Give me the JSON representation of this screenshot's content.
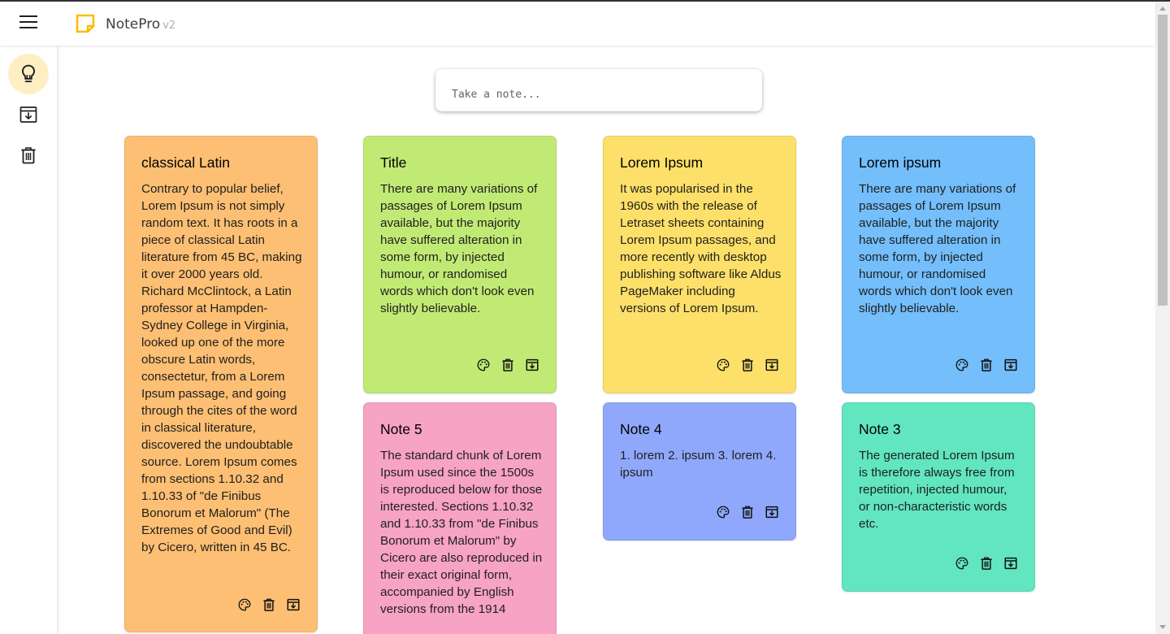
{
  "app": {
    "name": "NotePro",
    "version": "v2"
  },
  "sidebar": {
    "items": [
      {
        "label": "Notes",
        "icon": "lightbulb-icon",
        "active": true
      },
      {
        "label": "Archive",
        "icon": "archive-icon",
        "active": false
      },
      {
        "label": "Trash",
        "icon": "trash-icon",
        "active": false
      }
    ]
  },
  "compose": {
    "placeholder": "Take a note..."
  },
  "colors": {
    "accent": "#feefc3",
    "logo": "#fbbc04"
  },
  "notes": [
    {
      "title": "classical Latin",
      "color": "#fdbf73",
      "body": "Contrary to popular belief, Lorem Ipsum is not simply random text. It has roots in a piece of classical Latin literature from 45 BC, making it over 2000 years old. Richard McClintock, a Latin professor at Hampden-Sydney College in Virginia, looked up one of the more obscure Latin words, consectetur, from a Lorem Ipsum passage, and going through the cites of the word in classical literature, discovered the undoubtable source. Lorem Ipsum comes from sections 1.10.32 and 1.10.33 of \"de Finibus Bonorum et Malorum\" (The Extremes of Good and Evil) by Cicero, written in 45 BC."
    },
    {
      "title": "Title",
      "color": "#c1ea75",
      "body": "There are many variations of passages of Lorem Ipsum available, but the majority have suffered alteration in some form, by injected humour, or randomised words which don't look even slightly believable."
    },
    {
      "title": "Lorem Ipsum",
      "color": "#fde069",
      "body": "It was popularised in the 1960s with the release of Letraset sheets containing Lorem Ipsum passages, and more recently with desktop publishing software like Aldus PageMaker including versions of Lorem Ipsum."
    },
    {
      "title": "Lorem ipsum",
      "color": "#73befb",
      "body": "There are many variations of passages of Lorem Ipsum available, but the majority have suffered alteration in some form, by injected humour, or randomised words which don't look even slightly believable."
    },
    {
      "title": "Note 5",
      "color": "#f7a3c4",
      "body": "The standard chunk of Lorem Ipsum used since the 1500s is reproduced below for those interested. Sections 1.10.32 and 1.10.33 from \"de Finibus Bonorum et Malorum\" by Cicero are also reproduced in their exact original form, accompanied by English versions from the 1914"
    },
    {
      "title": "Note 4",
      "color": "#8fa8fc",
      "body": "1. lorem 2. ipsum 3. lorem 4. ipsum"
    },
    {
      "title": "Note 3",
      "color": "#61e6bf",
      "body": "The generated Lorem Ipsum is therefore always free from repetition, injected humour, or non-characteristic words etc."
    }
  ]
}
